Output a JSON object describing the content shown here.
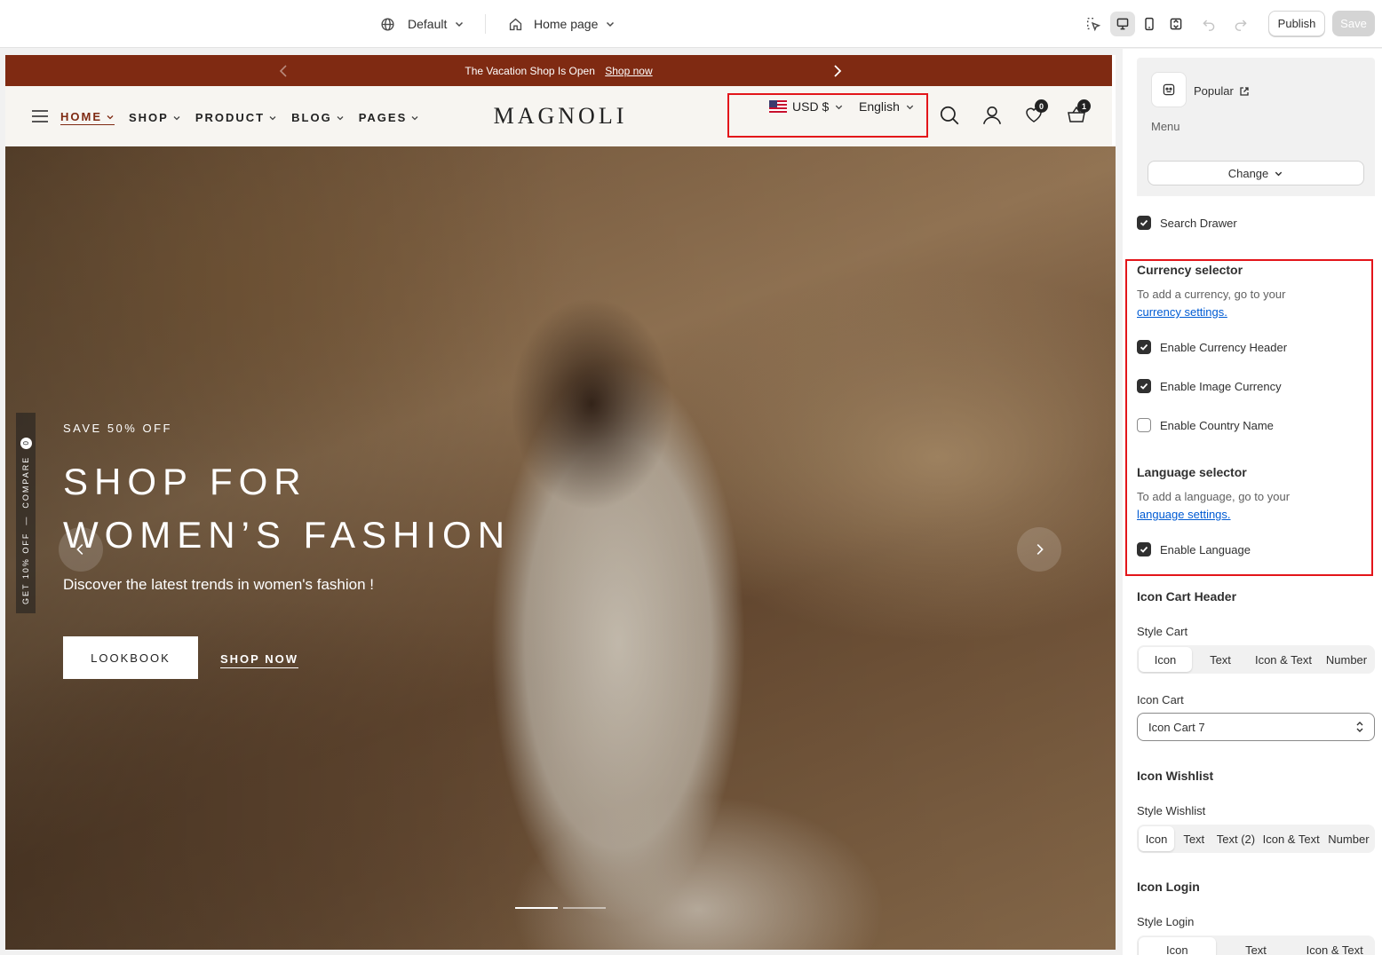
{
  "topbar": {
    "theme_label": "Default",
    "page_label": "Home page",
    "publish_label": "Publish",
    "save_label": "Save"
  },
  "preview": {
    "announcement": {
      "text": "The Vacation Shop Is Open",
      "link": "Shop now"
    },
    "nav": [
      {
        "label": "HOME"
      },
      {
        "label": "SHOP"
      },
      {
        "label": "PRODUCT"
      },
      {
        "label": "BLOG"
      },
      {
        "label": "PAGES"
      }
    ],
    "logo": "MAGNOLI",
    "currency": "USD $",
    "language": "English",
    "wishlist_count": "0",
    "cart_count": "1",
    "hero": {
      "subtitle": "SAVE 50% OFF",
      "title_line1": "SHOP FOR",
      "title_line2": "WOMEN’S FASHION",
      "description": "Discover the latest trends in women's fashion !",
      "primary_button": "LOOKBOOK",
      "secondary_link": "SHOP NOW"
    },
    "side_tab": {
      "compare_label": "COMPARE",
      "compare_count": "0",
      "discount_label": "GET 10% OFF"
    }
  },
  "panel": {
    "menu": {
      "name": "Popular",
      "label": "Menu",
      "change_label": "Change"
    },
    "search_drawer": {
      "label": "Search Drawer",
      "checked": true
    },
    "currency_selector": {
      "title": "Currency selector",
      "help": "To add a currency, go to your",
      "link": "currency settings.",
      "options": [
        {
          "label": "Enable Currency Header",
          "checked": true
        },
        {
          "label": "Enable Image Currency",
          "checked": true
        },
        {
          "label": "Enable Country Name",
          "checked": false
        }
      ]
    },
    "language_selector": {
      "title": "Language selector",
      "help": "To add a language, go to your",
      "link": "language settings.",
      "option": {
        "label": "Enable Language",
        "checked": true
      }
    },
    "icon_cart_header": {
      "title": "Icon Cart Header",
      "style_label": "Style Cart",
      "style_options": [
        "Icon",
        "Text",
        "Icon & Text",
        "Number"
      ],
      "style_selected": "Icon",
      "icon_label": "Icon Cart",
      "icon_value": "Icon Cart 7"
    },
    "icon_wishlist": {
      "title": "Icon Wishlist",
      "style_label": "Style Wishlist",
      "style_options": [
        "Icon",
        "Text",
        "Text (2)",
        "Icon & Text",
        "Number"
      ],
      "style_selected": "Icon"
    },
    "icon_login": {
      "title": "Icon Login",
      "style_label": "Style Login",
      "style_options": [
        "Icon",
        "Text",
        "Icon & Text"
      ],
      "style_selected": "Icon"
    }
  },
  "colors": {
    "announcement_bg": "#7f2a12",
    "highlight": "#e3151a",
    "link": "#005bd3"
  }
}
